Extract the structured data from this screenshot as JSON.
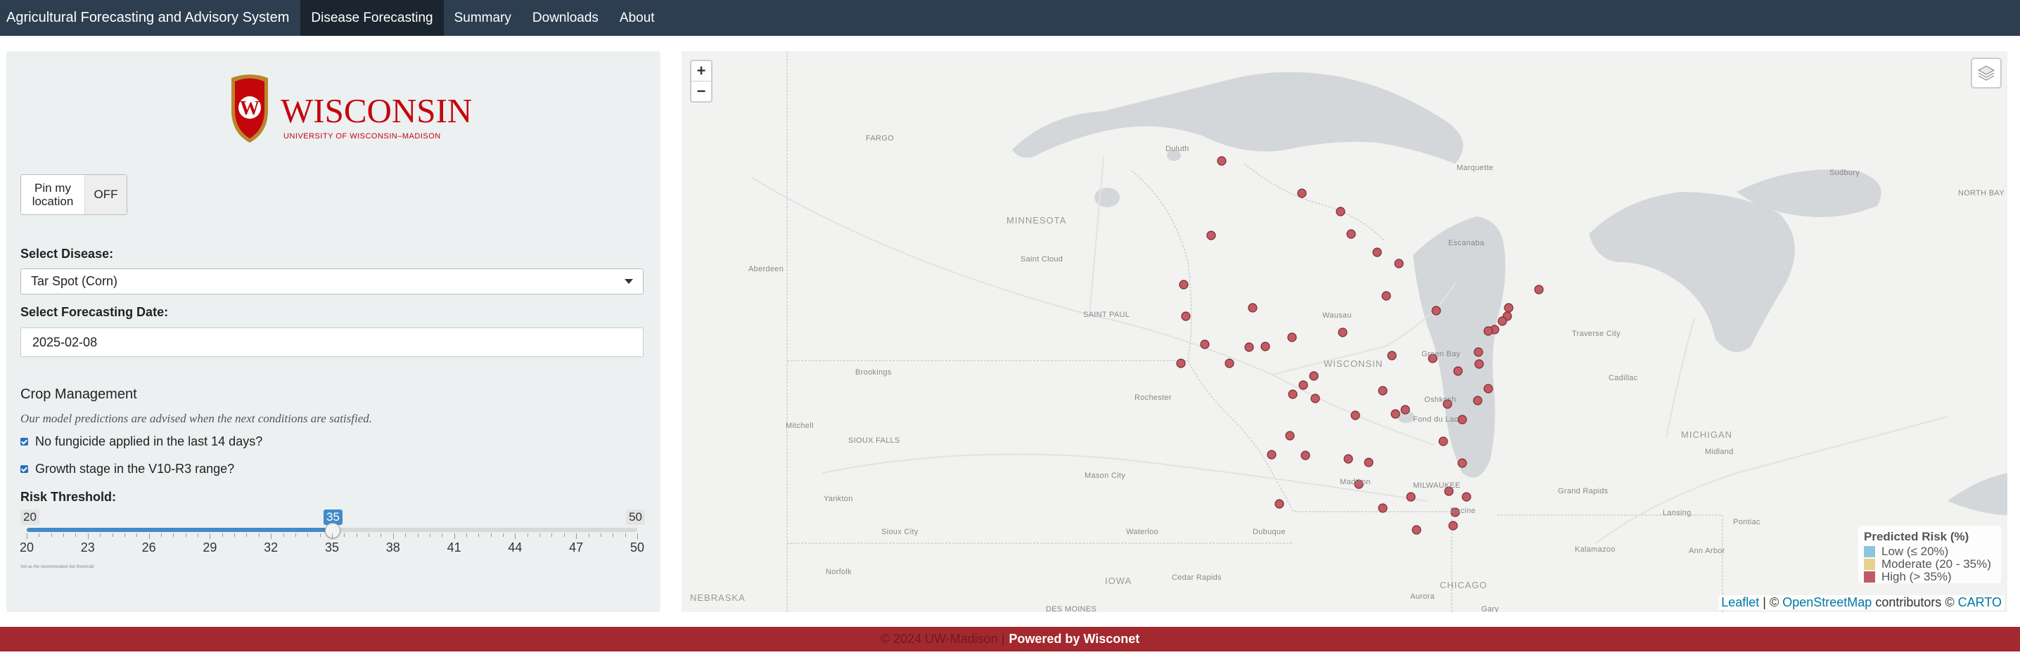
{
  "navbar": {
    "brand": "Agricultural Forecasting and Advisory System",
    "tabs": [
      {
        "label": "Disease Forecasting",
        "active": true
      },
      {
        "label": "Summary",
        "active": false
      },
      {
        "label": "Downloads",
        "active": false
      },
      {
        "label": "About",
        "active": false
      }
    ]
  },
  "logo": {
    "word": "WISCONSIN",
    "subtitle": "UNIVERSITY OF WISCONSIN–MADISON",
    "crest_letter": "W"
  },
  "pin": {
    "label": "Pin my location",
    "state": "OFF"
  },
  "disease": {
    "label": "Select Disease:",
    "value": "Tar Spot (Corn)"
  },
  "date": {
    "label": "Select Forecasting Date:",
    "value": "2025-02-08"
  },
  "crop_management": {
    "title": "Crop Management",
    "note": "Our model predictions are advised when the next conditions are satisfied.",
    "checks": [
      {
        "label": "No fungicide applied in the last 14 days?",
        "checked": true
      },
      {
        "label": "Growth stage in the V10-R3 range?",
        "checked": true
      }
    ]
  },
  "risk": {
    "label": "Risk Threshold:",
    "min": 20,
    "max": 50,
    "value": 35,
    "min_label": "20",
    "max_label": "50",
    "value_label": "35",
    "ticks": [
      "20",
      "23",
      "26",
      "29",
      "32",
      "35",
      "38",
      "41",
      "44",
      "47",
      "50"
    ],
    "help": "Set as the recommended risk threshold"
  },
  "map": {
    "zoom_in": "+",
    "zoom_out": "−",
    "labels": {
      "fargo": "FARGO",
      "duluth": "Duluth",
      "minnesota": "MINNESOTA",
      "saint_cloud": "Saint Cloud",
      "aberdeen": "Aberdeen",
      "saint_paul": "SAINT PAUL",
      "brookings": "Brookings",
      "rochester": "Rochester",
      "mitchell": "Mitchell",
      "sioux_falls": "SIOUX FALLS",
      "mason_city": "Mason City",
      "yankton": "Yankton",
      "sioux_city": "Sioux City",
      "waterloo": "Waterloo",
      "dubuque": "Dubuque",
      "norfolk": "Norfolk",
      "iowa": "IOWA",
      "cedar_rapids": "Cedar Rapids",
      "nebraska": "NEBRASKA",
      "des_moines": "DES MOINES",
      "wausau": "Wausau",
      "wisconsin": "WISCONSIN",
      "green_bay": "Green Bay",
      "oshkosh": "Oshkosh",
      "fond_du_lac": "Fond du Lac",
      "madison": "Madison",
      "milwaukee": "MILWAUKEE",
      "racine": "Racine",
      "chicago": "CHICAGO",
      "aurora": "Aurora",
      "gary": "Gary",
      "marquette": "Marquette",
      "escanaba": "Escanaba",
      "sudbury": "Sudbury",
      "north_bay": "NORTH BAY",
      "traverse_city": "Traverse City",
      "cadillac": "Cadillac",
      "michigan": "MICHIGAN",
      "midland": "Midland",
      "grand_rapids": "Grand Rapids",
      "lansing": "Lansing",
      "pontiac": "Pontiac",
      "kalamazoo": "Kalamazoo",
      "ann_arbor": "Ann Arbor"
    }
  },
  "legend": {
    "title": "Predicted Risk (%)",
    "items": [
      {
        "label": "Low (≤ 20%)",
        "color": "#8fc4e0"
      },
      {
        "label": "Moderate (20 - 35%)",
        "color": "#e6d28a"
      },
      {
        "label": "High (> 35%)",
        "color": "#c25b63"
      }
    ]
  },
  "attribution": {
    "leaflet": "Leaflet",
    "sep": " | © ",
    "osm": "OpenStreetMap",
    "contrib": " contributors © ",
    "carto": "CARTO"
  },
  "footer": {
    "copyright": "© 2024 UW-Madison |",
    "powered": "Powered by Wisconet"
  },
  "colors": {
    "navbar": "#2c3e50",
    "nav_active": "#1a252f",
    "footer": "#a3292f",
    "marker": "#c25b63",
    "slider": "#428bca",
    "uw_red": "#c5050c"
  }
}
